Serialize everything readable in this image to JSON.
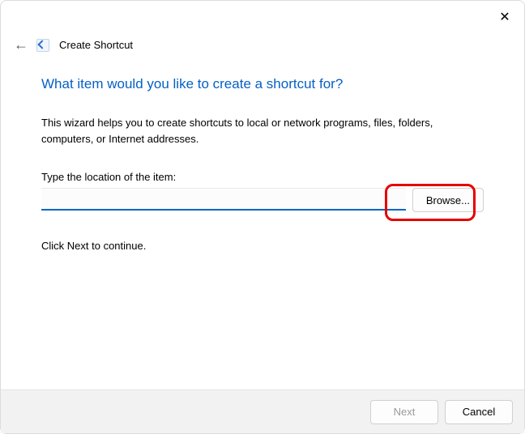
{
  "window": {
    "title": "Create Shortcut"
  },
  "main": {
    "heading": "What item would you like to create a shortcut for?",
    "description": "This wizard helps you to create shortcuts to local or network programs, files, folders, computers, or Internet addresses.",
    "field_label": "Type the location of the item:",
    "location_value": "",
    "browse_label": "Browse...",
    "continue_hint": "Click Next to continue."
  },
  "footer": {
    "next_label": "Next",
    "cancel_label": "Cancel"
  }
}
